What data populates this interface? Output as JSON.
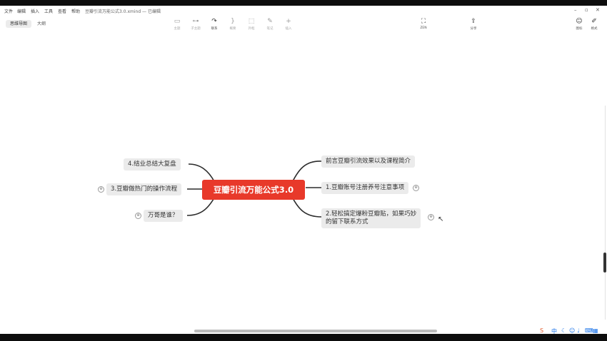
{
  "menu": [
    "文件",
    "编辑",
    "插入",
    "工具",
    "查看",
    "帮助"
  ],
  "document": {
    "title": "豆瓣引流万能公式3.0.xmind — 已编辑"
  },
  "views": {
    "mindmap": "思维导图",
    "outline": "大纲"
  },
  "tools": [
    {
      "icon": "▭",
      "label": "主题"
    },
    {
      "icon": "⊶",
      "label": "子主题"
    },
    {
      "icon": "↷",
      "label": "联系"
    },
    {
      "icon": "}",
      "label": "概要"
    },
    {
      "icon": "⬚",
      "label": "外框"
    },
    {
      "icon": "✎",
      "label": "笔记"
    },
    {
      "icon": "+",
      "label": "插入"
    }
  ],
  "zen": {
    "icon": "⛶",
    "label": "ZEN"
  },
  "share": {
    "icon": "⇪",
    "label": "分享"
  },
  "panel": {
    "icon_label": "图标",
    "format_label": "格式"
  },
  "mindmap": {
    "root": "豆瓣引流万能公式3.0",
    "right": [
      {
        "text": "前言豆瓣引流效果以及课程简介"
      },
      {
        "text": "1.豆瓣账号注册养号注意事项",
        "collapsed": "⊕"
      },
      {
        "text": "2.轻松搞定爆粉豆瓣贴，如果巧妙的留下联系方式",
        "line1": "2.轻松搞定爆粉豆瓣贴，如果巧妙",
        "line2": "的留下联系方式",
        "collapsed": "⊕"
      }
    ],
    "left": [
      {
        "text": "4.结业总结大复盘"
      },
      {
        "text": "3.豆瓣做热门的操作流程",
        "collapsed": "⊕"
      },
      {
        "text": "万哥是谁？",
        "collapsed": "⊕"
      }
    ]
  },
  "taskbar": {
    "ime": "中"
  }
}
